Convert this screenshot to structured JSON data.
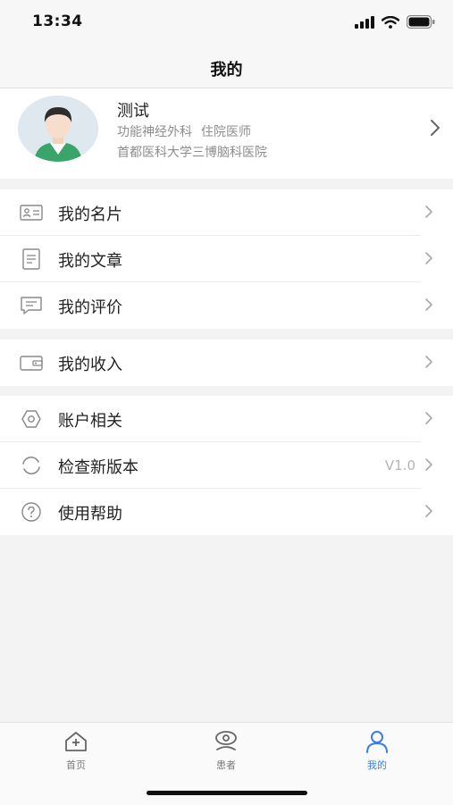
{
  "status_bar": {
    "time": "13:34"
  },
  "nav": {
    "title": "我的"
  },
  "profile": {
    "name": "测试",
    "department": "功能神经外科",
    "position": "住院医师",
    "hospital": "首都医科大学三博脑科医院"
  },
  "menu_group1": [
    {
      "label": "我的名片",
      "icon": "id-card-icon"
    },
    {
      "label": "我的文章",
      "icon": "document-icon"
    },
    {
      "label": "我的评价",
      "icon": "comment-icon"
    }
  ],
  "menu_group2": [
    {
      "label": "我的收入",
      "icon": "wallet-icon"
    }
  ],
  "menu_group3": [
    {
      "label": "账户相关",
      "icon": "settings-icon"
    },
    {
      "label": "检查新版本",
      "icon": "refresh-icon",
      "value": "V1.0"
    },
    {
      "label": "使用帮助",
      "icon": "help-icon"
    }
  ],
  "tab_bar": {
    "tabs": [
      {
        "label": "首页",
        "icon": "home-icon"
      },
      {
        "label": "患者",
        "icon": "patient-icon"
      },
      {
        "label": "我的",
        "icon": "profile-icon",
        "active": true
      }
    ]
  },
  "colors": {
    "accent": "#3b7ee0",
    "background": "#f3f3f4"
  }
}
